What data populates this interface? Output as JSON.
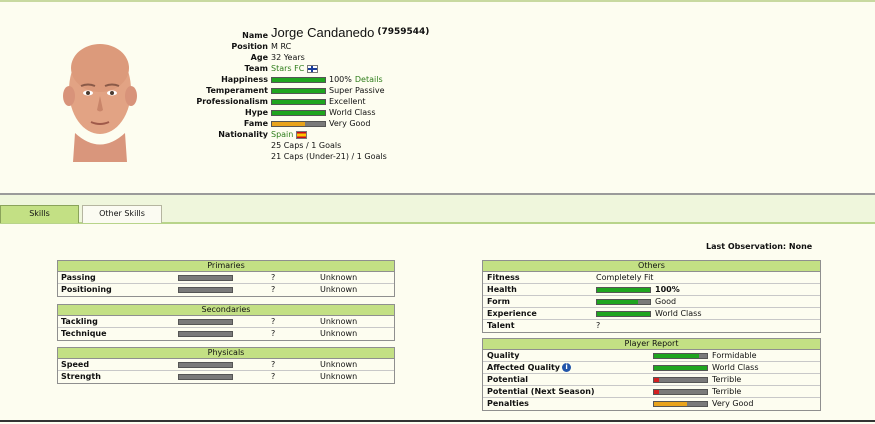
{
  "player": {
    "name": "Jorge Candanedo",
    "id": "(7959544)",
    "position": "M RC",
    "age": "32 Years",
    "team": "Stars FC",
    "happiness": {
      "value": 1.0,
      "text": "100%",
      "link": "Details"
    },
    "temperament": {
      "value": 1.0,
      "text": "Super Passive"
    },
    "professionalism": {
      "value": 1.0,
      "text": "Excellent"
    },
    "hype": {
      "value": 1.0,
      "text": "World Class"
    },
    "fame": {
      "value": 0.62,
      "text": "Very Good"
    },
    "nationality": "Spain",
    "caps": "25 Caps / 1 Goals",
    "caps_u21": "21 Caps (Under-21) / 1 Goals"
  },
  "labels": {
    "name": "Name",
    "position": "Position",
    "age": "Age",
    "team": "Team",
    "happiness": "Happiness",
    "temperament": "Temperament",
    "professionalism": "Professionalism",
    "hype": "Hype",
    "fame": "Fame",
    "nationality": "Nationality"
  },
  "tabs": [
    {
      "label": "Skills",
      "active": true
    },
    {
      "label": "Other Skills",
      "active": false
    }
  ],
  "last_observation": "Last Observation: None",
  "skills": {
    "primaries": {
      "title": "Primaries",
      "rows": [
        {
          "label": "Passing",
          "q": "?",
          "status": "Unknown"
        },
        {
          "label": "Positioning",
          "q": "?",
          "status": "Unknown"
        }
      ]
    },
    "secondaries": {
      "title": "Secondaries",
      "rows": [
        {
          "label": "Tackling",
          "q": "?",
          "status": "Unknown"
        },
        {
          "label": "Technique",
          "q": "?",
          "status": "Unknown"
        }
      ]
    },
    "physicals": {
      "title": "Physicals",
      "rows": [
        {
          "label": "Speed",
          "q": "?",
          "status": "Unknown"
        },
        {
          "label": "Strength",
          "q": "?",
          "status": "Unknown"
        }
      ]
    }
  },
  "others": {
    "title": "Others",
    "fitness_label": "Fitness",
    "fitness": "Completely Fit",
    "health_label": "Health",
    "health": {
      "value": 1.0,
      "text": "100%"
    },
    "form_label": "Form",
    "form": {
      "value": 0.78,
      "text": "Good"
    },
    "experience_label": "Experience",
    "experience": {
      "value": 1.0,
      "text": "World Class"
    },
    "talent_label": "Talent",
    "talent": "?"
  },
  "report": {
    "title": "Player Report",
    "quality_label": "Quality",
    "quality": {
      "value": 0.85,
      "text": "Formidable"
    },
    "affected_quality_label": "Affected Quality",
    "affected_quality": {
      "value": 1.0,
      "text": "World Class"
    },
    "potential_label": "Potential",
    "potential": {
      "value": 0.1,
      "text": "Terrible"
    },
    "potential_next_label": "Potential (Next Season)",
    "potential_next": {
      "value": 0.1,
      "text": "Terrible"
    },
    "penalties_label": "Penalties",
    "penalties": {
      "value": 0.62,
      "text": "Very Good"
    }
  },
  "colors": {
    "green": "#1fa51f",
    "orange": "#e8a31c",
    "red": "#d42020",
    "gray": "#7a7a7a"
  }
}
